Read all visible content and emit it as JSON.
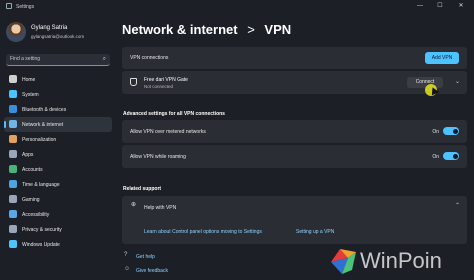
{
  "window": {
    "title": "Settings",
    "minimize": "—",
    "maximize": "☐",
    "close": "✕"
  },
  "profile": {
    "name": "Gylang Satria",
    "email": "gylangsatria@outlook.com"
  },
  "search": {
    "placeholder": "Find a setting",
    "icon": "search-icon"
  },
  "sidebar": {
    "items": [
      {
        "label": "Home",
        "icon": "home-icon",
        "color": "#cfcfcf"
      },
      {
        "label": "System",
        "icon": "monitor-icon",
        "color": "#4cc2ff"
      },
      {
        "label": "Bluetooth & devices",
        "icon": "bluetooth-icon",
        "color": "#3a8fd9"
      },
      {
        "label": "Network & internet",
        "icon": "network-icon",
        "color": "#6fb5e8",
        "active": true
      },
      {
        "label": "Personalization",
        "icon": "brush-icon",
        "color": "#e2a15d"
      },
      {
        "label": "Apps",
        "icon": "apps-icon",
        "color": "#9aa6b8"
      },
      {
        "label": "Accounts",
        "icon": "person-icon",
        "color": "#48b37a"
      },
      {
        "label": "Time & language",
        "icon": "globe-icon",
        "color": "#4ca3e0"
      },
      {
        "label": "Gaming",
        "icon": "gamepad-icon",
        "color": "#9aa6b8"
      },
      {
        "label": "Accessibility",
        "icon": "accessibility-icon",
        "color": "#5aa8e8"
      },
      {
        "label": "Privacy & security",
        "icon": "shield-icon",
        "color": "#9aa6b8"
      },
      {
        "label": "Windows Update",
        "icon": "update-icon",
        "color": "#4cc2ff"
      }
    ]
  },
  "breadcrumb": {
    "parent": "Network & internet",
    "separator": ">",
    "current": "VPN"
  },
  "vpn_connections": {
    "label": "VPN connections",
    "add_button": "Add VPN"
  },
  "vpn_entry": {
    "name": "Free dari VPN Gate",
    "status": "Not connected",
    "connect_button": "Connect"
  },
  "advanced": {
    "title": "Advanced settings for all VPN connections",
    "metered": {
      "label": "Allow VPN over metered networks",
      "state": "On"
    },
    "roaming": {
      "label": "Allow VPN while roaming",
      "state": "On"
    }
  },
  "related": {
    "title": "Related support",
    "help": "Help with VPN",
    "link1": "Learn about Control panel options moving to Settings",
    "link2": "Setting up a VPN"
  },
  "footer": {
    "get_help": "Get help",
    "feedback": "Give feedback"
  },
  "watermark": {
    "text": "WinPoin"
  },
  "colors": {
    "accent": "#4cc2ff",
    "background": "#1c1f26",
    "card": "#2a2d34"
  }
}
